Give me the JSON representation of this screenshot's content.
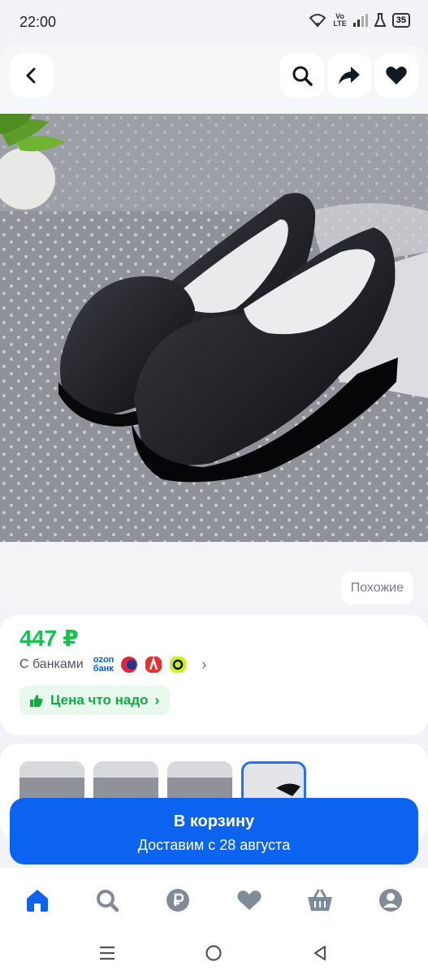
{
  "status_bar": {
    "time": "22:00",
    "volte_top": "Vo",
    "volte_bottom": "LTE",
    "battery": "35"
  },
  "header": {
    "back_icon": "chevron-left-icon",
    "search_icon": "search-icon",
    "share_icon": "share-icon",
    "favorite_icon": "heart-icon"
  },
  "product": {
    "similar_label": "Похожие",
    "price": "447 ₽",
    "banks_label": "С банками",
    "ozon_bank_line1": "ozon",
    "ozon_bank_line2": "банк",
    "good_price_label": "Цена что надо"
  },
  "cart": {
    "title": "В корзину",
    "subtitle": "Доставим с 28 августа"
  },
  "bottom_nav": [
    "home-icon",
    "search-icon",
    "ruble-icon",
    "heart-icon",
    "basket-icon",
    "profile-icon"
  ],
  "colors": {
    "brand_blue": "#0b63f0",
    "price_green": "#10c44c",
    "nav_active": "#0b63f0",
    "nav_inactive": "#7f8b98"
  }
}
